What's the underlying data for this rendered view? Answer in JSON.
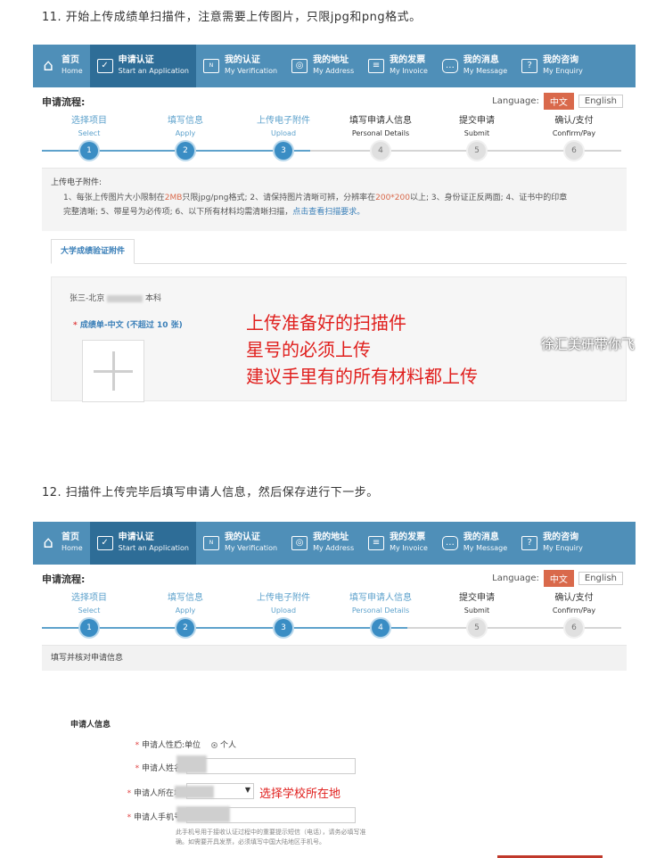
{
  "caption1": "11. 开始上传成绩单扫描件，注意需要上传图片，只限jpg和png格式。",
  "caption2": "12. 扫描件上传完毕后填写申请人信息，然后保存进行下一步。",
  "nav": [
    {
      "zh": "首页",
      "en": "Home",
      "icon": "home-icon"
    },
    {
      "zh": "申请认证",
      "en": "Start an Application",
      "icon": "check-icon"
    },
    {
      "zh": "我的认证",
      "en": "My Verification",
      "icon": "new-icon"
    },
    {
      "zh": "我的地址",
      "en": "My Address",
      "icon": "address-icon"
    },
    {
      "zh": "我的发票",
      "en": "My Invoice",
      "icon": "invoice-icon"
    },
    {
      "zh": "我的消息",
      "en": "My Message",
      "icon": "message-icon"
    },
    {
      "zh": "我的咨询",
      "en": "My Enquiry",
      "icon": "enquiry-icon"
    }
  ],
  "flow_title": "申请流程:",
  "language_label": "Language:",
  "lang_zh": "中文",
  "lang_en": "English",
  "steps": [
    {
      "zh": "选择项目",
      "en": "Select",
      "num": "1"
    },
    {
      "zh": "填写信息",
      "en": "Apply",
      "num": "2"
    },
    {
      "zh": "上传电子附件",
      "en": "Upload",
      "num": "3"
    },
    {
      "zh": "填写申请人信息",
      "en": "Personal Details",
      "num": "4"
    },
    {
      "zh": "提交申请",
      "en": "Submit",
      "num": "5"
    },
    {
      "zh": "确认/支付",
      "en": "Confirm/Pay",
      "num": "6"
    }
  ],
  "shot1": {
    "completed_steps": 3,
    "upload_title": "上传电子附件:",
    "note_a": "1、每张上传图片大小限制在",
    "note_size": "2MB",
    "note_b": "只限jpg/png格式; 2、请保持图片清晰可辨，分辨率在",
    "note_res": "200*200",
    "note_c": "以上; 3、身份证正反两面; 4、证书中的印章",
    "note_d": "完整清晰; 5、带星号为必传项; 6、以下所有材料均需清晰扫描，",
    "note_link": "点击查看扫描要求。",
    "tab_label": "大学成绩验证附件",
    "file_prefix": "张三-北京",
    "file_suffix": "本科",
    "req_star": "*",
    "req_label": "成绩单-中文 (不超过 10 张)",
    "overlay_lines": [
      "上传准备好的扫描件",
      "星号的必须上传",
      "建议手里有的所有材料都上传"
    ],
    "watermark": "徐汇美研带你飞"
  },
  "shot2": {
    "completed_steps": 4,
    "fill_header": "填写并核对申请信息",
    "info_title": "申请人信息",
    "field_type": "申请人性质:",
    "opt_unit": "单位",
    "opt_person": "个人",
    "field_name": "申请人姓名:",
    "field_location": "申请人所在地:",
    "location_annotation": "选择学校所在地",
    "field_phone": "申请人手机号:",
    "hint_line1": "此手机号用于接收认证过程中的重要提示短信（电话），请务必填写准",
    "hint_line2": "确。如需要开具发票，必须填写中国大陆地区手机号。"
  }
}
